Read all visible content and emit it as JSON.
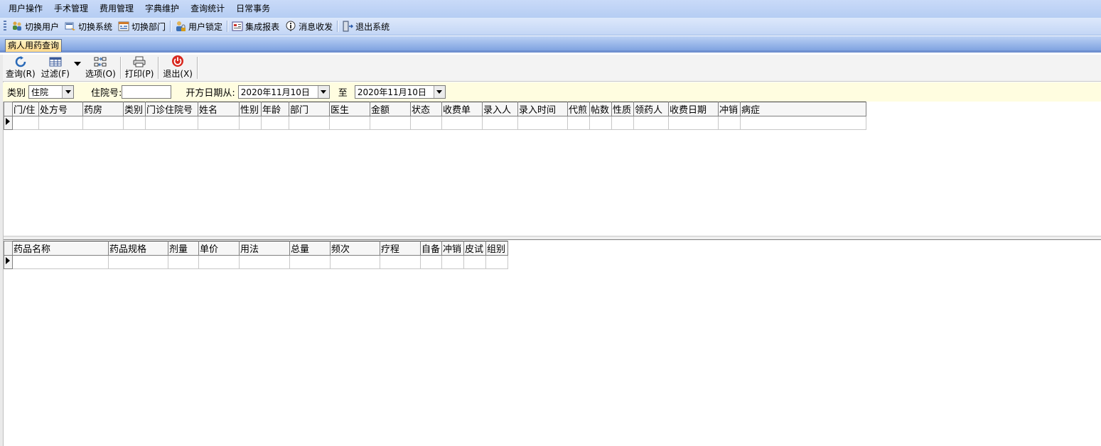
{
  "menu": [
    "用户操作",
    "手术管理",
    "费用管理",
    "字典维护",
    "查询统计",
    "日常事务"
  ],
  "toolbar": {
    "switch_user": "切换用户",
    "switch_system": "切换系统",
    "switch_dept": "切换部门",
    "lock_user": "用户锁定",
    "report": "集成报表",
    "messages": "消息收发",
    "exit_system": "退出系统"
  },
  "tab": {
    "label": "病人用药查询"
  },
  "actions": {
    "query": "查询(R)",
    "filter": "过滤(F)",
    "options": "选项(O)",
    "print": "打印(P)",
    "exit": "退出(X)"
  },
  "filter": {
    "category_label": "类别",
    "category_value": "住院",
    "inpatient_no_label": "住院号:",
    "inpatient_no_value": "",
    "date_from_label": "开方日期从:",
    "date_from": "2020年11月10日",
    "to_label": "至",
    "date_to": "2020年11月10日"
  },
  "prescription_grid": {
    "columns": [
      "门/住",
      "处方号",
      "药房",
      "类别",
      "门诊住院号",
      "姓名",
      "性别",
      "年龄",
      "部门",
      "医生",
      "金额",
      "状态",
      "收费单",
      "录入人",
      "录入时间",
      "代煎",
      "帖数",
      "性质",
      "领药人",
      "收费日期",
      "冲销",
      "病症"
    ]
  },
  "drug_grid": {
    "columns": [
      "药品名称",
      "药品规格",
      "剂量",
      "单价",
      "用法",
      "总量",
      "频次",
      "疗程",
      "自备",
      "冲销",
      "皮试",
      "组别"
    ]
  }
}
